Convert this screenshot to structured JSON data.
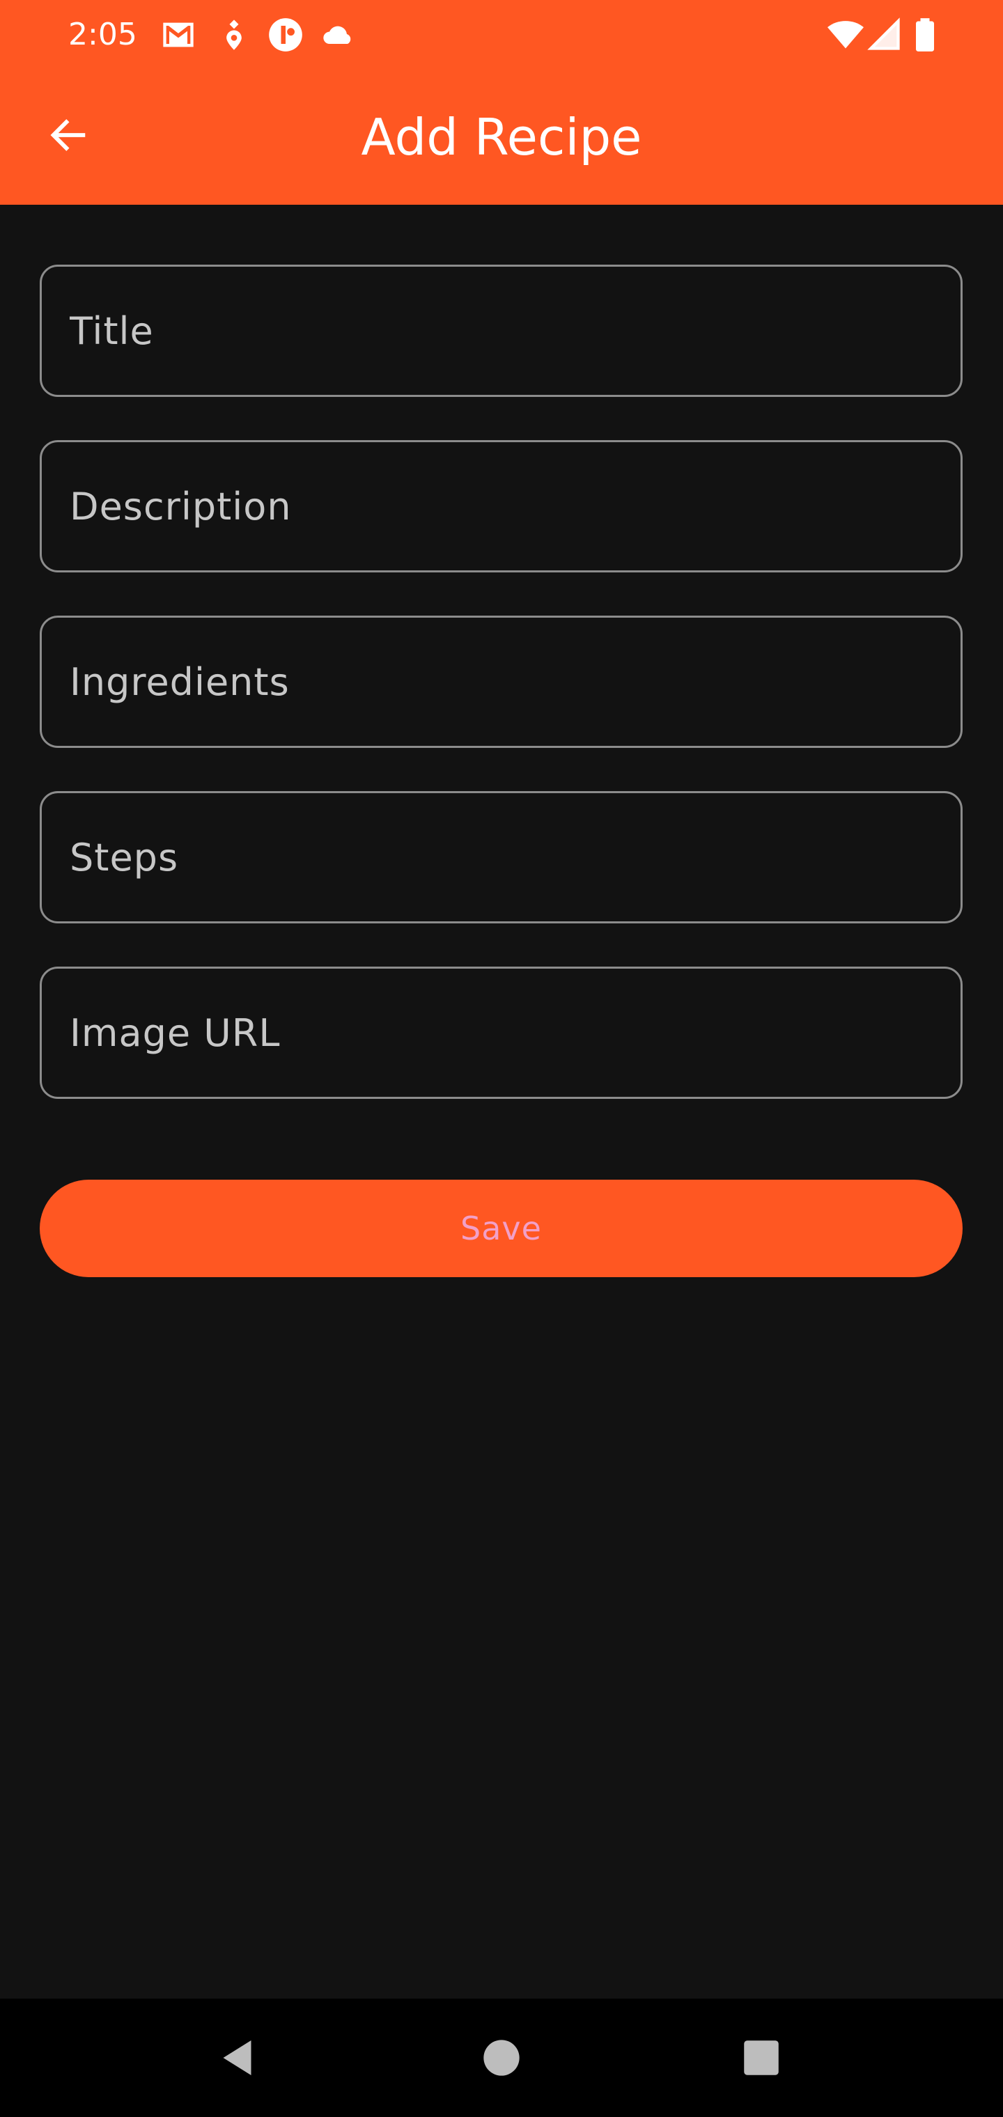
{
  "status_bar": {
    "time": "2:05",
    "icons": [
      "gmail-icon",
      "location-pin-icon",
      "app-badge-icon",
      "cloud-icon",
      "wifi-icon",
      "cellular-signal-icon",
      "battery-icon"
    ]
  },
  "toolbar": {
    "title": "Add Recipe",
    "back_icon": "arrow-back-icon"
  },
  "form": {
    "title_placeholder": "Title",
    "description_placeholder": "Description",
    "ingredients_placeholder": "Ingredients",
    "steps_placeholder": "Steps",
    "image_url_placeholder": "Image URL"
  },
  "actions": {
    "save_label": "Save"
  },
  "navigation": {
    "icons": [
      "nav-back-icon",
      "nav-home-icon",
      "nav-recents-icon"
    ]
  },
  "colors": {
    "accent": "#ff5722",
    "background": "#121212",
    "field_border": "#8c8c8c",
    "save_text": "#f2a0c8"
  }
}
